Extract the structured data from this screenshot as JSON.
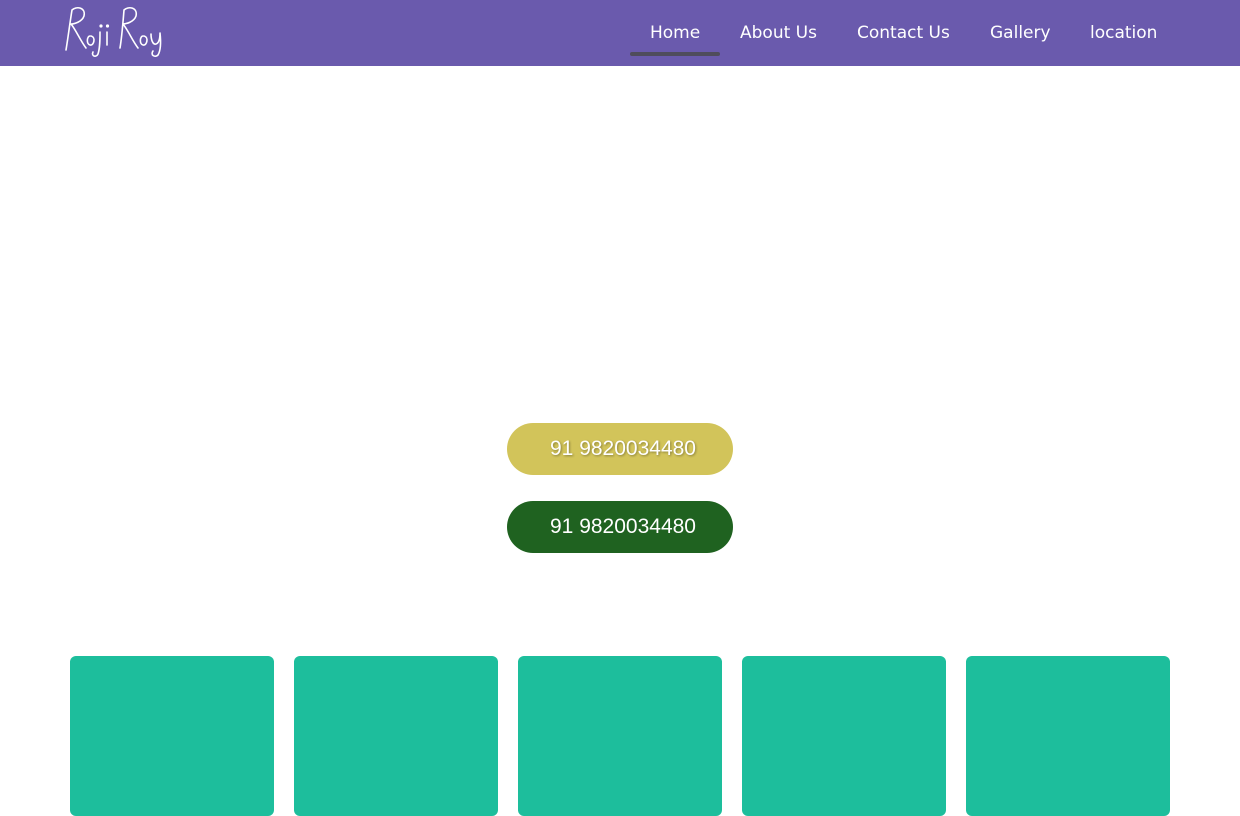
{
  "brand": {
    "logo_text": "Roji Roy",
    "bar_color": "#6a5aad"
  },
  "nav": {
    "items": [
      {
        "label": "Home",
        "active": true
      },
      {
        "label": "About Us",
        "active": false
      },
      {
        "label": "Contact Us",
        "active": false
      },
      {
        "label": "Gallery",
        "active": false
      },
      {
        "label": "location",
        "active": false
      }
    ]
  },
  "contact_buttons": {
    "call": {
      "label": "91 9820034480",
      "color": "#d2c45a",
      "icon": "phone-icon"
    },
    "whatsapp": {
      "label": "91 9820034480",
      "color": "#1f6220",
      "icon": "whatsapp-icon"
    }
  },
  "tiles": {
    "count": 5,
    "color": "#1dbe9c"
  }
}
